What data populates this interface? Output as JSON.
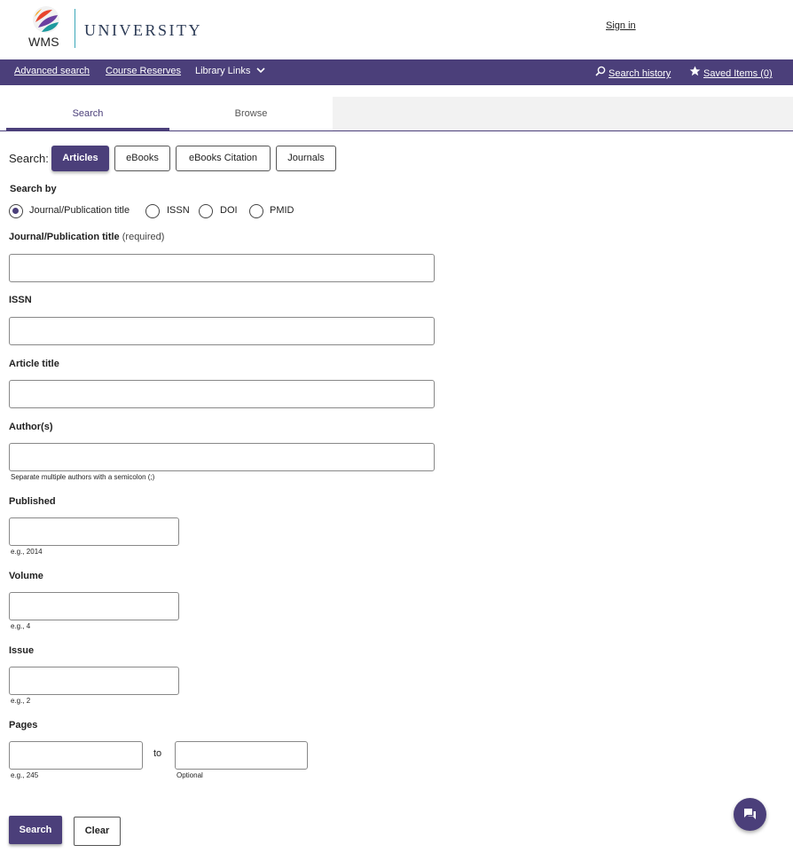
{
  "header": {
    "logo_text": "WMS",
    "university": "UNIVERSITY",
    "sign_in": "Sign in"
  },
  "nav": {
    "advanced_search": "Advanced search",
    "course_reserves": "Course Reserves",
    "library_links": "Library Links",
    "search_history": "Search history",
    "saved_items": "Saved Items (0)"
  },
  "tabs": {
    "search": "Search",
    "browse": "Browse"
  },
  "search": {
    "label": "Search:",
    "types": [
      "Articles",
      "eBooks",
      "eBooks Citation",
      "Journals"
    ],
    "active_type": "Articles"
  },
  "search_by": {
    "label": "Search by",
    "options": [
      "Journal/Publication title",
      "ISSN",
      "DOI",
      "PMID"
    ],
    "selected": "Journal/Publication title"
  },
  "fields": {
    "journal_title": "Journal/Publication title",
    "required": "(required)",
    "issn": "ISSN",
    "article_title": "Article title",
    "authors": "Author(s)",
    "authors_hint": "Separate multiple authors with a semicolon (;)",
    "published": "Published",
    "published_hint": "e.g., 2014",
    "volume": "Volume",
    "volume_hint": "e.g., 4",
    "issue": "Issue",
    "issue_hint": "e.g., 2",
    "pages": "Pages",
    "pages_hint": "e.g., 245",
    "to": "to",
    "optional_hint": "Optional"
  },
  "buttons": {
    "search": "Search",
    "clear": "Clear"
  },
  "icons": {
    "search_history": "magnifier-history-icon",
    "saved_items": "star-icon",
    "chat": "chat-icon",
    "library_links": "chevron-down-icon"
  },
  "colors": {
    "brand": "#4b3f7a",
    "accent": "#3aa7b8"
  }
}
